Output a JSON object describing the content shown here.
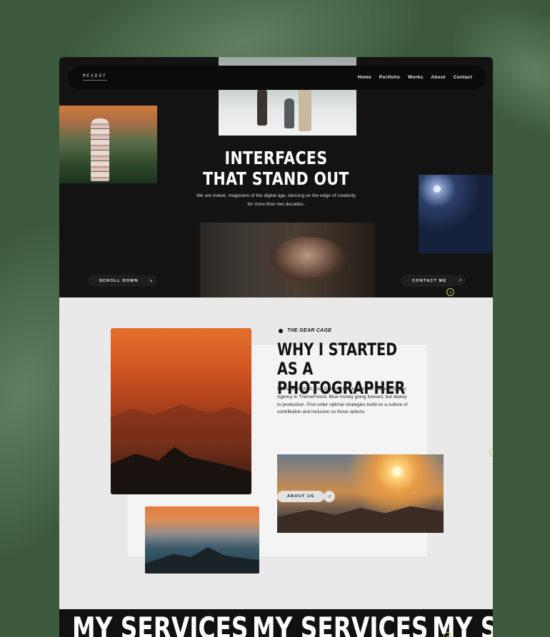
{
  "site": {
    "logo": "MEXDOT",
    "nav": [
      "Home",
      "Portfolio",
      "Works",
      "About",
      "Contact"
    ]
  },
  "hero": {
    "title_line1": "INTERFACES",
    "title_line2": "THAT STAND OUT",
    "subtitle": "We are maker, magicians of the digital age, dancing on the edge of creativity for more than two decades.",
    "scroll_label": "SCROLL DOWN",
    "scroll_icon": "arrow-down-right-icon",
    "contact_label": "CONTACT ME",
    "contact_icon": "arrow-up-right-icon"
  },
  "about": {
    "kicker": "THE GEAR CAGE",
    "title_line1": "WHY I STARTED",
    "title_line2": "AS A PHOTOGRAPHER",
    "text": "Founded in 2000, Dsn Grid has become one of the best Digital Agency in ThemeForest. Blue money going forward, but deploy to production. First-order optimal strategies build on a culture of contribution and inclusion so those options",
    "button_label": "ABOUT US",
    "button_icon": "arrow-up-right-icon"
  },
  "services": {
    "marquee": [
      "MY SERVICES",
      "MY SERVICES",
      "MY SERVICES"
    ]
  },
  "colors": {
    "background": "#3d5a3f",
    "hero_bg": "#131313",
    "about_bg": "#e9e9e9",
    "accent": "#b9d84a"
  }
}
